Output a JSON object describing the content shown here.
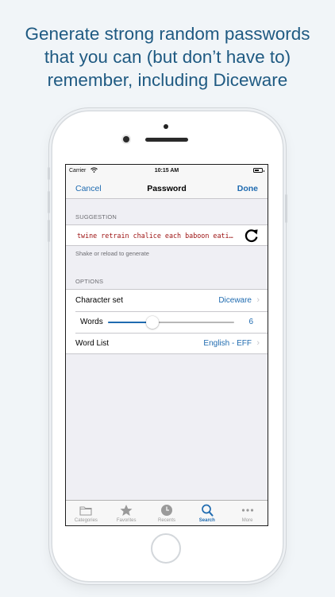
{
  "headline": {
    "line1": "Generate strong random passwords",
    "line2": "that you can (but don’t have to)",
    "line3": "remember, including Diceware"
  },
  "status_bar": {
    "carrier": "Carrier",
    "time": "10:15 AM"
  },
  "nav": {
    "cancel": "Cancel",
    "title": "Password",
    "done": "Done"
  },
  "suggestion": {
    "header": "SUGGESTION",
    "password": "twine retrain chalice each baboon eati…",
    "footer": "Shake or reload to generate"
  },
  "options": {
    "header": "OPTIONS",
    "character_set": {
      "label": "Character set",
      "value": "Diceware"
    },
    "words": {
      "label": "Words",
      "value": "6",
      "slider_fraction": 0.35
    },
    "word_list": {
      "label": "Word List",
      "value": "English - EFF"
    }
  },
  "tabs": [
    {
      "label": "Categories",
      "icon": "folder-icon",
      "active": false
    },
    {
      "label": "Favorites",
      "icon": "star-icon",
      "active": false
    },
    {
      "label": "Recents",
      "icon": "clock-icon",
      "active": false
    },
    {
      "label": "Search",
      "icon": "search-icon",
      "active": true
    },
    {
      "label": "More",
      "icon": "more-icon",
      "active": false
    }
  ],
  "colors": {
    "headline": "#1f5a82",
    "accent": "#1f6bb0",
    "password_text": "#9c1010",
    "background": "#f1f5f8"
  }
}
